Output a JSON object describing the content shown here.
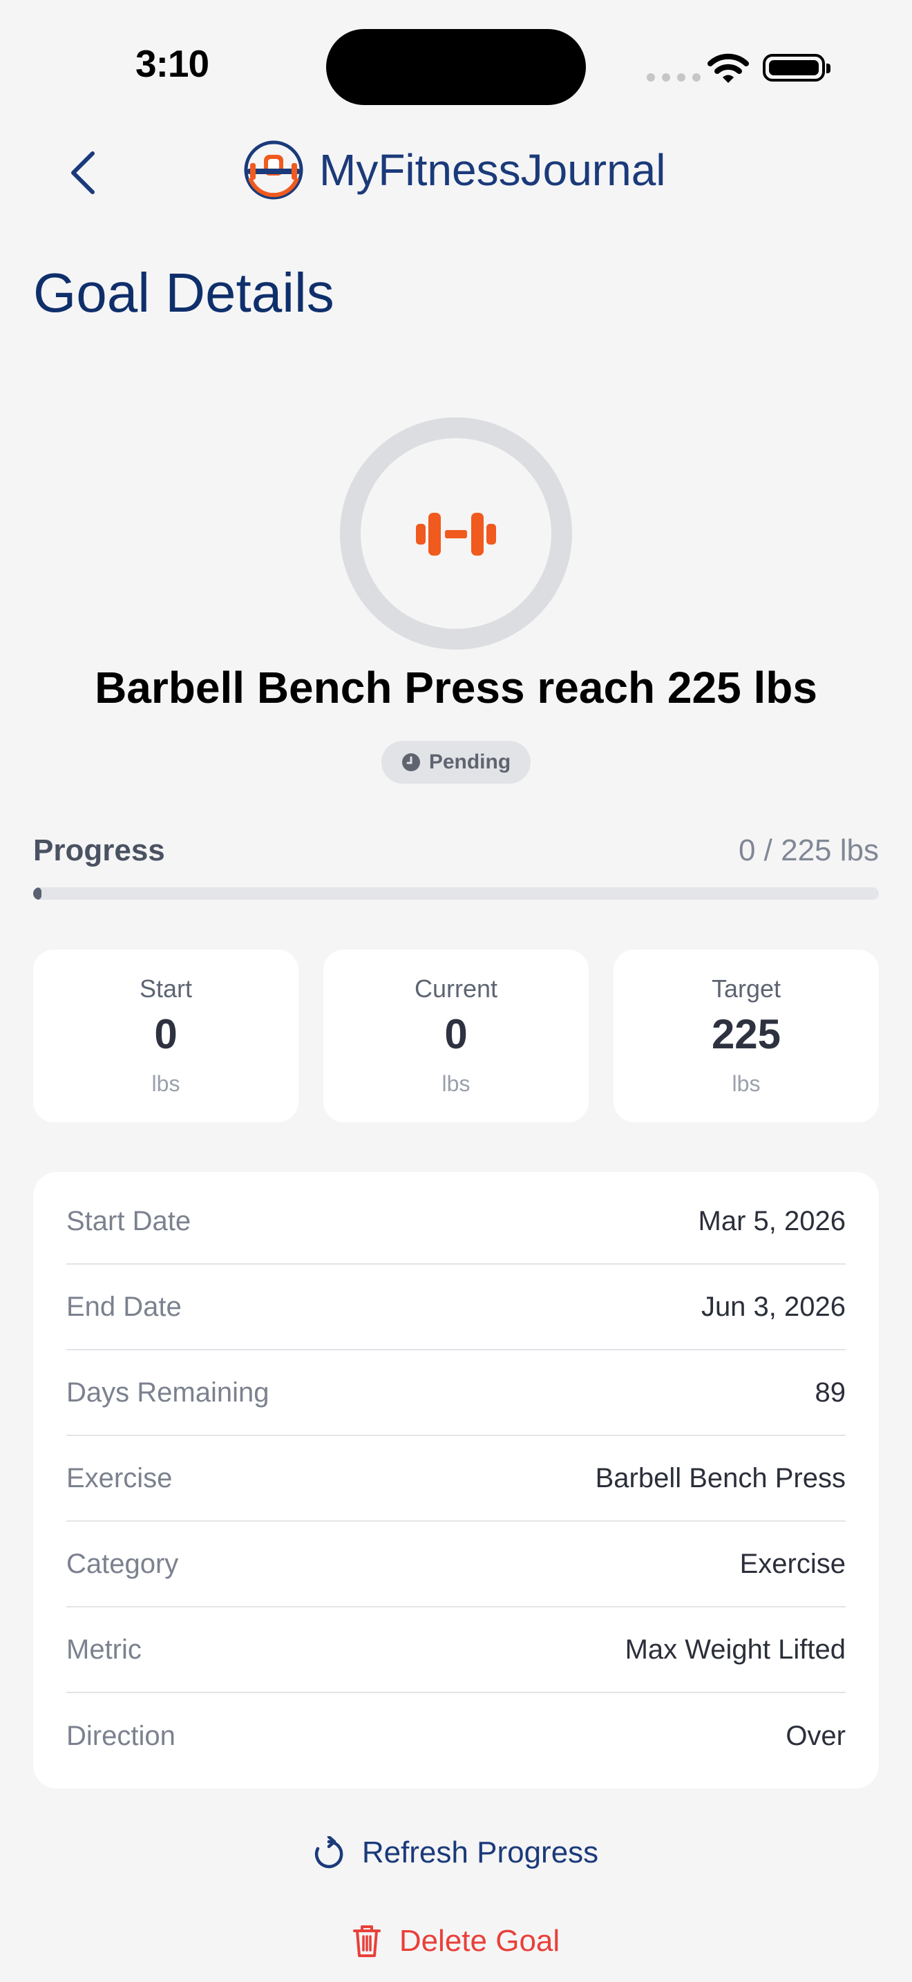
{
  "status_bar": {
    "time": "3:10"
  },
  "header": {
    "app_name": "MyFitnessJournal"
  },
  "page": {
    "title": "Goal Details"
  },
  "goal": {
    "title": "Barbell Bench Press reach 225 lbs",
    "status": "Pending"
  },
  "progress": {
    "label": "Progress",
    "value_text": "0 / 225 lbs",
    "fraction": 0.0
  },
  "stats": [
    {
      "label": "Start",
      "value": "0",
      "unit": "lbs"
    },
    {
      "label": "Current",
      "value": "0",
      "unit": "lbs"
    },
    {
      "label": "Target",
      "value": "225",
      "unit": "lbs"
    }
  ],
  "details": [
    {
      "label": "Start Date",
      "value": "Mar 5, 2026"
    },
    {
      "label": "End Date",
      "value": "Jun 3, 2026"
    },
    {
      "label": "Days Remaining",
      "value": "89"
    },
    {
      "label": "Exercise",
      "value": "Barbell Bench Press"
    },
    {
      "label": "Category",
      "value": "Exercise"
    },
    {
      "label": "Metric",
      "value": "Max Weight Lifted"
    },
    {
      "label": "Direction",
      "value": "Over"
    }
  ],
  "actions": {
    "refresh_label": "Refresh Progress",
    "delete_label": "Delete Goal"
  },
  "colors": {
    "brand_navy": "#1b3a7a",
    "accent_orange": "#f05a1e",
    "danger_red": "#e8403a"
  },
  "icons": {
    "back": "chevron-left-icon",
    "logo": "dumbbell-logo-icon",
    "goal": "dumbbell-icon",
    "status": "clock-icon",
    "refresh": "refresh-icon",
    "delete": "trash-icon"
  }
}
